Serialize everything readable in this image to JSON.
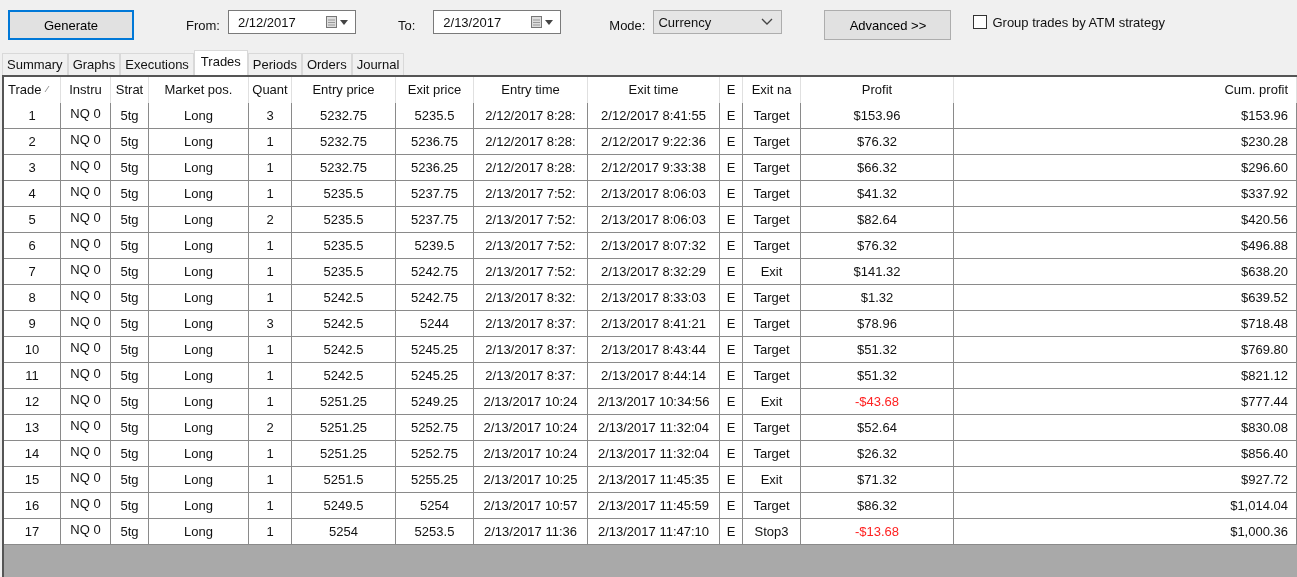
{
  "toolbar": {
    "generate": "Generate",
    "from_label": "From:",
    "from_date": "2/12/2017",
    "to_label": "To:",
    "to_date": "2/13/2017",
    "mode_label": "Mode:",
    "mode": "Currency",
    "advanced": "Advanced >>",
    "group_checkbox": {
      "label": "Group trades by ATM strategy",
      "checked": false
    }
  },
  "tabs": [
    {
      "label": "Summary",
      "selected": false
    },
    {
      "label": "Graphs",
      "selected": false
    },
    {
      "label": "Executions",
      "selected": false
    },
    {
      "label": "Trades",
      "selected": true
    },
    {
      "label": "Periods",
      "selected": false
    },
    {
      "label": "Orders",
      "selected": false
    },
    {
      "label": "Journal",
      "selected": false
    }
  ],
  "table": {
    "columns": [
      {
        "label": "Trade",
        "sorted": true
      },
      {
        "label": "Instru",
        "sorted": false
      },
      {
        "label": "Strat",
        "sorted": false
      },
      {
        "label": "Market pos.",
        "sorted": false
      },
      {
        "label": "Quant",
        "sorted": false
      },
      {
        "label": "Entry price",
        "sorted": false
      },
      {
        "label": "Exit price",
        "sorted": false
      },
      {
        "label": "Entry time",
        "sorted": false
      },
      {
        "label": "Exit time",
        "sorted": false
      },
      {
        "label": "E",
        "sorted": false
      },
      {
        "label": "Exit na",
        "sorted": false
      },
      {
        "label": "Profit",
        "sorted": false
      },
      {
        "label": "Cum. profit",
        "sorted": false
      }
    ],
    "rows": [
      {
        "cells": [
          "1",
          "NQ 0",
          "5tg",
          "Long",
          "3",
          "5232.75",
          "5235.5",
          "2/12/2017 8:28:",
          "2/12/2017 8:41:55",
          "E",
          "Target",
          "$153.96",
          "$153.96"
        ],
        "loss": false
      },
      {
        "cells": [
          "2",
          "NQ 0",
          "5tg",
          "Long",
          "1",
          "5232.75",
          "5236.75",
          "2/12/2017 8:28:",
          "2/12/2017 9:22:36",
          "E",
          "Target",
          "$76.32",
          "$230.28"
        ],
        "loss": false
      },
      {
        "cells": [
          "3",
          "NQ 0",
          "5tg",
          "Long",
          "1",
          "5232.75",
          "5236.25",
          "2/12/2017 8:28:",
          "2/12/2017 9:33:38",
          "E",
          "Target",
          "$66.32",
          "$296.60"
        ],
        "loss": false
      },
      {
        "cells": [
          "4",
          "NQ 0",
          "5tg",
          "Long",
          "1",
          "5235.5",
          "5237.75",
          "2/13/2017 7:52:",
          "2/13/2017 8:06:03",
          "E",
          "Target",
          "$41.32",
          "$337.92"
        ],
        "loss": false
      },
      {
        "cells": [
          "5",
          "NQ 0",
          "5tg",
          "Long",
          "2",
          "5235.5",
          "5237.75",
          "2/13/2017 7:52:",
          "2/13/2017 8:06:03",
          "E",
          "Target",
          "$82.64",
          "$420.56"
        ],
        "loss": false
      },
      {
        "cells": [
          "6",
          "NQ 0",
          "5tg",
          "Long",
          "1",
          "5235.5",
          "5239.5",
          "2/13/2017 7:52:",
          "2/13/2017 8:07:32",
          "E",
          "Target",
          "$76.32",
          "$496.88"
        ],
        "loss": false
      },
      {
        "cells": [
          "7",
          "NQ 0",
          "5tg",
          "Long",
          "1",
          "5235.5",
          "5242.75",
          "2/13/2017 7:52:",
          "2/13/2017 8:32:29",
          "E",
          "Exit",
          "$141.32",
          "$638.20"
        ],
        "loss": false
      },
      {
        "cells": [
          "8",
          "NQ 0",
          "5tg",
          "Long",
          "1",
          "5242.5",
          "5242.75",
          "2/13/2017 8:32:",
          "2/13/2017 8:33:03",
          "E",
          "Target",
          "$1.32",
          "$639.52"
        ],
        "loss": false
      },
      {
        "cells": [
          "9",
          "NQ 0",
          "5tg",
          "Long",
          "3",
          "5242.5",
          "5244",
          "2/13/2017 8:37:",
          "2/13/2017 8:41:21",
          "E",
          "Target",
          "$78.96",
          "$718.48"
        ],
        "loss": false
      },
      {
        "cells": [
          "10",
          "NQ 0",
          "5tg",
          "Long",
          "1",
          "5242.5",
          "5245.25",
          "2/13/2017 8:37:",
          "2/13/2017 8:43:44",
          "E",
          "Target",
          "$51.32",
          "$769.80"
        ],
        "loss": false
      },
      {
        "cells": [
          "11",
          "NQ 0",
          "5tg",
          "Long",
          "1",
          "5242.5",
          "5245.25",
          "2/13/2017 8:37:",
          "2/13/2017 8:44:14",
          "E",
          "Target",
          "$51.32",
          "$821.12"
        ],
        "loss": false
      },
      {
        "cells": [
          "12",
          "NQ 0",
          "5tg",
          "Long",
          "1",
          "5251.25",
          "5249.25",
          "2/13/2017 10:24",
          "2/13/2017 10:34:56",
          "E",
          "Exit",
          "-$43.68",
          "$777.44"
        ],
        "loss": true
      },
      {
        "cells": [
          "13",
          "NQ 0",
          "5tg",
          "Long",
          "2",
          "5251.25",
          "5252.75",
          "2/13/2017 10:24",
          "2/13/2017 11:32:04",
          "E",
          "Target",
          "$52.64",
          "$830.08"
        ],
        "loss": false
      },
      {
        "cells": [
          "14",
          "NQ 0",
          "5tg",
          "Long",
          "1",
          "5251.25",
          "5252.75",
          "2/13/2017 10:24",
          "2/13/2017 11:32:04",
          "E",
          "Target",
          "$26.32",
          "$856.40"
        ],
        "loss": false
      },
      {
        "cells": [
          "15",
          "NQ 0",
          "5tg",
          "Long",
          "1",
          "5251.5",
          "5255.25",
          "2/13/2017 10:25",
          "2/13/2017 11:45:35",
          "E",
          "Exit",
          "$71.32",
          "$927.72"
        ],
        "loss": false
      },
      {
        "cells": [
          "16",
          "NQ 0",
          "5tg",
          "Long",
          "1",
          "5249.5",
          "5254",
          "2/13/2017 10:57",
          "2/13/2017 11:45:59",
          "E",
          "Target",
          "$86.32",
          "$1,014.04"
        ],
        "loss": false
      },
      {
        "cells": [
          "17",
          "NQ 0",
          "5tg",
          "Long",
          "1",
          "5254",
          "5253.5",
          "2/13/2017 11:36",
          "2/13/2017 11:47:10",
          "E",
          "Stop3",
          "-$13.68",
          "$1,000.36"
        ],
        "loss": true
      }
    ]
  }
}
